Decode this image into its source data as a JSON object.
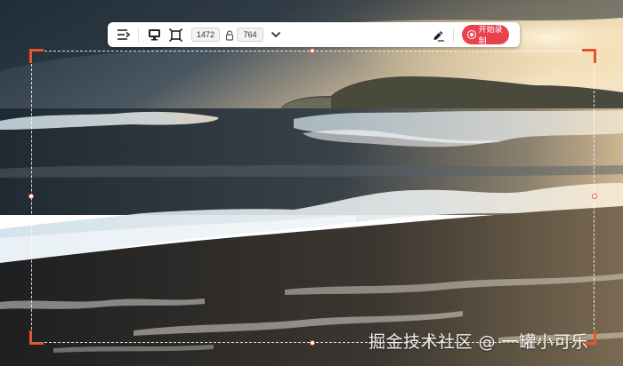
{
  "toolbar": {
    "width_value": "1472",
    "height_value": "764",
    "record_label": "开始录制",
    "icons": {
      "menu": "menu-collapse-icon",
      "screen": "screen-capture-icon",
      "region": "region-select-icon",
      "lock": "aspect-lock-icon",
      "dropdown": "chevron-down-icon",
      "pen": "pen-annotate-icon",
      "record": "record-icon"
    }
  },
  "colors": {
    "accent": "#e4572e",
    "record": "#e8424f"
  },
  "watermark": "掘金技术社区 @ 一罐小可乐"
}
